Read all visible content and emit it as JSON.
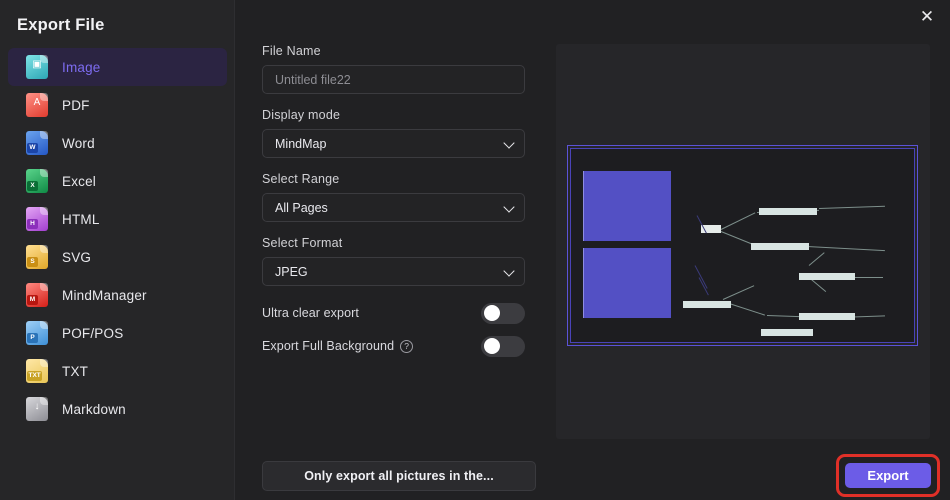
{
  "dialog": {
    "title": "Export File",
    "close_icon": "close-icon"
  },
  "sidebar": {
    "items": [
      {
        "label": "Image",
        "icon": "image-file-icon",
        "tag": "",
        "glyph": "▣",
        "color1": "#7fe3e6",
        "color2": "#2da6b5",
        "tagcolor": "#0e8a9b",
        "selected": true
      },
      {
        "label": "PDF",
        "icon": "pdf-file-icon",
        "tag": "",
        "glyph": "A",
        "color1": "#ff9287",
        "color2": "#e03b2e",
        "tagcolor": "#c62a20",
        "selected": false
      },
      {
        "label": "Word",
        "icon": "word-file-icon",
        "tag": "W",
        "glyph": "",
        "color1": "#6ba4ef",
        "color2": "#2457c5",
        "tagcolor": "#1b45a8",
        "selected": false
      },
      {
        "label": "Excel",
        "icon": "excel-file-icon",
        "tag": "X",
        "glyph": "",
        "color1": "#5ad48b",
        "color2": "#0f8a45",
        "tagcolor": "#0a6e36",
        "selected": false
      },
      {
        "label": "HTML",
        "icon": "html-file-icon",
        "tag": "H",
        "glyph": "",
        "color1": "#e4a6f5",
        "color2": "#a23ed0",
        "tagcolor": "#8c2fbb",
        "selected": false
      },
      {
        "label": "SVG",
        "icon": "svg-file-icon",
        "tag": "S",
        "glyph": "",
        "color1": "#ffdf92",
        "color2": "#e0a728",
        "tagcolor": "#c98f14",
        "selected": false
      },
      {
        "label": "MindManager",
        "icon": "mindmanager-file-icon",
        "tag": "M",
        "glyph": "",
        "color1": "#ff8a82",
        "color2": "#d41f18",
        "tagcolor": "#b81610",
        "selected": false
      },
      {
        "label": "POF/POS",
        "icon": "pof-pos-file-icon",
        "tag": "P",
        "glyph": "",
        "color1": "#9fd0f7",
        "color2": "#3e8fd6",
        "tagcolor": "#2a73b8",
        "selected": false
      },
      {
        "label": "TXT",
        "icon": "txt-file-icon",
        "tag": "TXT",
        "glyph": "",
        "color1": "#ffe8a8",
        "color2": "#e8c556",
        "tagcolor": "#c9a326",
        "selected": false
      },
      {
        "label": "Markdown",
        "icon": "markdown-file-icon",
        "tag": "",
        "glyph": "↓",
        "color1": "#d8d8dc",
        "color2": "#8d8d94",
        "tagcolor": "#4a4a50",
        "selected": false
      }
    ]
  },
  "form": {
    "file_name": {
      "label": "File Name",
      "value": "",
      "placeholder": "Untitled file22"
    },
    "display_mode": {
      "label": "Display mode",
      "value": "MindMap",
      "chevron_icon": "chevron-down-icon"
    },
    "select_range": {
      "label": "Select Range",
      "value": "All Pages",
      "chevron_icon": "chevron-down-icon"
    },
    "select_format": {
      "label": "Select Format",
      "value": "JPEG",
      "chevron_icon": "chevron-down-icon"
    },
    "ultra_clear_export": {
      "label": "Ultra clear export",
      "state": "off"
    },
    "export_full_background": {
      "label": "Export Full Background",
      "state": "off",
      "help_icon": "help-circle-icon",
      "help_glyph": "?"
    }
  },
  "footer": {
    "secondary_label": "Only export all pictures in the...",
    "export_label": "Export",
    "export_accent": "#6c5ce7",
    "highlight_color": "#e03028"
  },
  "preview": {
    "name": "export-preview",
    "map_accent": "#5350c4",
    "frame_color": "#5b52d8"
  }
}
